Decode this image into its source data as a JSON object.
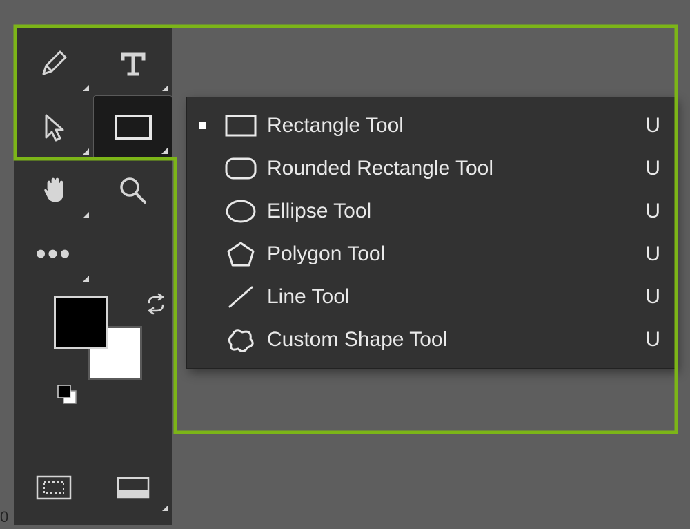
{
  "toolbar": {
    "tools": [
      {
        "name": "pen-tool",
        "hasFlyout": true
      },
      {
        "name": "type-tool",
        "hasFlyout": true
      },
      {
        "name": "path-selection-tool",
        "hasFlyout": true
      },
      {
        "name": "rectangle-shape-tool",
        "hasFlyout": true,
        "selected": true
      },
      {
        "name": "hand-tool",
        "hasFlyout": true
      },
      {
        "name": "zoom-tool",
        "hasFlyout": false
      },
      {
        "name": "edit-toolbar",
        "hasFlyout": true
      },
      {
        "name": "",
        "hasFlyout": false
      }
    ],
    "foregroundColor": "#000000",
    "backgroundColor": "#ffffff",
    "quickMaskOff": true,
    "screenMode": "standard"
  },
  "flyout": {
    "items": [
      {
        "icon": "rectangle-icon",
        "label": "Rectangle Tool",
        "shortcut": "U",
        "active": true
      },
      {
        "icon": "rounded-rectangle-icon",
        "label": "Rounded Rectangle Tool",
        "shortcut": "U",
        "active": false
      },
      {
        "icon": "ellipse-icon",
        "label": "Ellipse Tool",
        "shortcut": "U",
        "active": false
      },
      {
        "icon": "polygon-icon",
        "label": "Polygon Tool",
        "shortcut": "U",
        "active": false
      },
      {
        "icon": "line-icon",
        "label": "Line Tool",
        "shortcut": "U",
        "active": false
      },
      {
        "icon": "custom-shape-icon",
        "label": "Custom Shape Tool",
        "shortcut": "U",
        "active": false
      }
    ]
  },
  "pageNumber": "0"
}
